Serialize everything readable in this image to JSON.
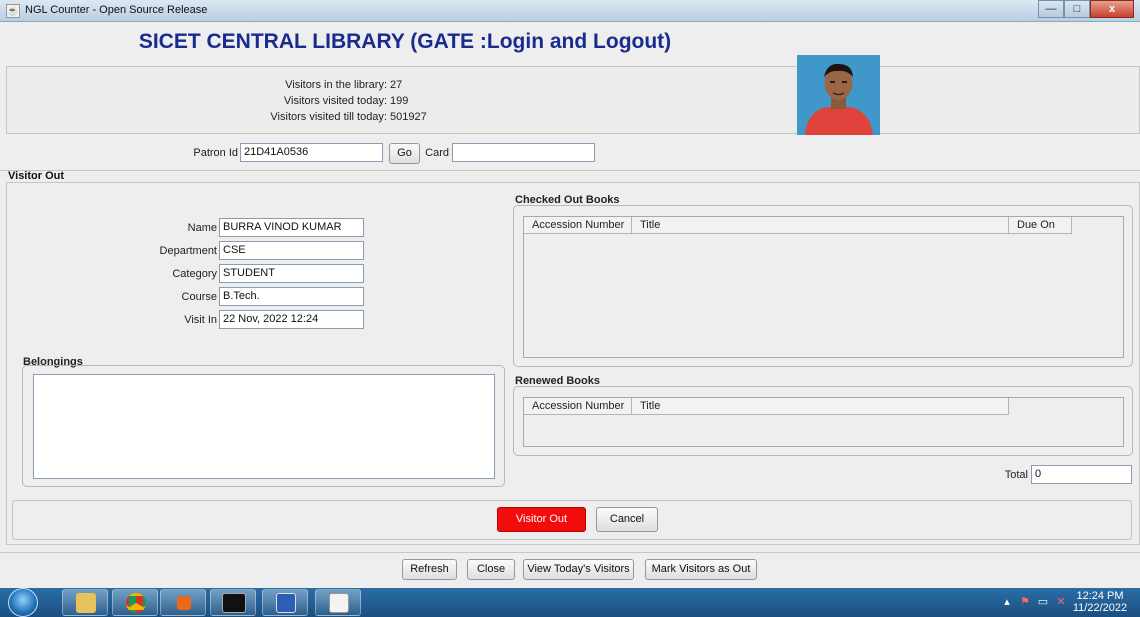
{
  "window": {
    "title": "NGL Counter - Open Source Release",
    "controls": {
      "minimize": "—",
      "maximize": "□",
      "close": "x"
    }
  },
  "header": {
    "title": "SICET CENTRAL LIBRARY (GATE :Login and Logout)"
  },
  "stats": [
    {
      "label": "Visitors in the library:",
      "value": "27"
    },
    {
      "label": "Visitors visited today:",
      "value": "199"
    },
    {
      "label": "Visitors visited till today:",
      "value": "501927"
    }
  ],
  "patron": {
    "label": "Patron Id",
    "value": "21D41A0536",
    "go_label": "Go",
    "card_label": "Card",
    "card_value": ""
  },
  "visitor_out": {
    "section_title": "Visitor Out",
    "fields": [
      {
        "label": "Name",
        "value": "BURRA VINOD KUMAR"
      },
      {
        "label": "Department",
        "value": "CSE"
      },
      {
        "label": "Category",
        "value": "STUDENT"
      },
      {
        "label": "Course",
        "value": "B.Tech."
      },
      {
        "label": "Visit In",
        "value": "22 Nov, 2022 12:24"
      }
    ],
    "belongings_title": "Belongings",
    "checked_out": {
      "title": "Checked Out Books",
      "columns": [
        "Accession Number",
        "Title",
        "Due On"
      ]
    },
    "renewed": {
      "title": "Renewed Books",
      "columns": [
        "Accession Number",
        "Title"
      ]
    },
    "total_label": "Total",
    "total_value": "0",
    "visitor_out_button": "Visitor Out",
    "cancel_button": "Cancel"
  },
  "bottom_buttons": {
    "refresh": "Refresh",
    "close": "Close",
    "view_today": "View Today's Visitors",
    "mark_out": "Mark Visitors as Out"
  },
  "taskbar": {
    "apps": [
      "file-explorer-icon",
      "chrome-icon",
      "media-player-icon",
      "command-prompt-icon",
      "word-icon",
      "java-icon"
    ],
    "time": "12:24 PM",
    "date": "11/22/2022"
  },
  "colors": {
    "title_blue": "#1a2b8f",
    "visitor_out_red": "#f20c0c",
    "taskbar": "#1b4f80"
  }
}
